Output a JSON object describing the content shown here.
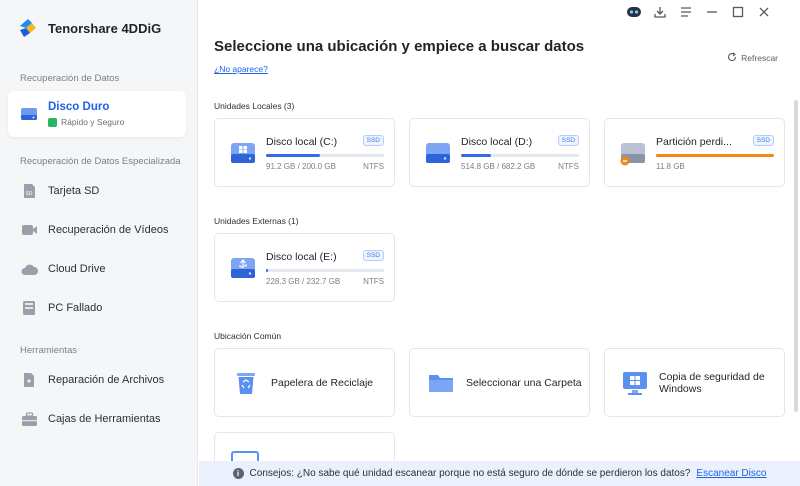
{
  "app": {
    "name": "Tenorshare 4DDiG"
  },
  "sidebar": {
    "sections": [
      "Recuperación de Datos",
      "Recuperación de Datos Especializada",
      "Herramientas"
    ],
    "active_item": {
      "label": "Disco Duro",
      "subtitle": "Rápido y Seguro",
      "icon": "hard-drive-icon"
    },
    "special_items": [
      {
        "label": "Tarjeta SD",
        "icon": "sd-card-icon"
      },
      {
        "label": "Recuperación de Vídeos",
        "icon": "video-icon"
      },
      {
        "label": "Cloud Drive",
        "icon": "cloud-icon"
      },
      {
        "label": "PC Fallado",
        "icon": "crashed-pc-icon"
      }
    ],
    "tool_items": [
      {
        "label": "Reparación de Archivos",
        "icon": "file-repair-icon"
      },
      {
        "label": "Cajas de Herramientas",
        "icon": "toolbox-icon"
      }
    ]
  },
  "main": {
    "title": "Seleccione una ubicación y empiece a buscar datos",
    "not_appear_link": "¿No aparece?",
    "refresh_label": "Refrescar",
    "local_label": "Unidades Locales (3)",
    "external_label": "Unidades Externas (1)",
    "common_label": "Ubicación Común",
    "local_drives": [
      {
        "name": "Disco local (C:)",
        "badge": "SSD",
        "size": "91.2 GB / 200.0 GB",
        "fs": "NTFS",
        "used_fraction": 0.456,
        "bar_color": "#2f6ee8"
      },
      {
        "name": "Disco local (D:)",
        "badge": "SSD",
        "size": "514.8 GB / 682.2 GB",
        "fs": "NTFS",
        "used_fraction": 0.25,
        "bar_color": "#2f6ee8"
      },
      {
        "name": "Partición perdi...",
        "badge": "SSD",
        "size": "11.8 GB",
        "fs": "",
        "used_fraction": 1.0,
        "bar_color": "#f08a16"
      }
    ],
    "external_drives": [
      {
        "name": "Disco local (E:)",
        "badge": "SSD",
        "size": "228.3 GB / 232.7 GB",
        "fs": "NTFS",
        "used_fraction": 0.02,
        "bar_color": "#2f6ee8"
      }
    ],
    "common_locations": [
      {
        "label": "Papelera de Reciclaje",
        "icon": "recycle-bin-icon"
      },
      {
        "label": "Seleccionar una Carpeta",
        "icon": "folder-icon"
      },
      {
        "label": "Copia de seguridad de Windows",
        "icon": "windows-backup-icon"
      }
    ]
  },
  "tip": {
    "text": "Consejos: ¿No sabe qué unidad escanear porque no está seguro de dónde se perdieron los datos?",
    "link": "Escanear Disco"
  },
  "colors": {
    "accent": "#1f63e6",
    "warning": "#f08a16",
    "sidebar_bg": "#f5f6f8"
  }
}
